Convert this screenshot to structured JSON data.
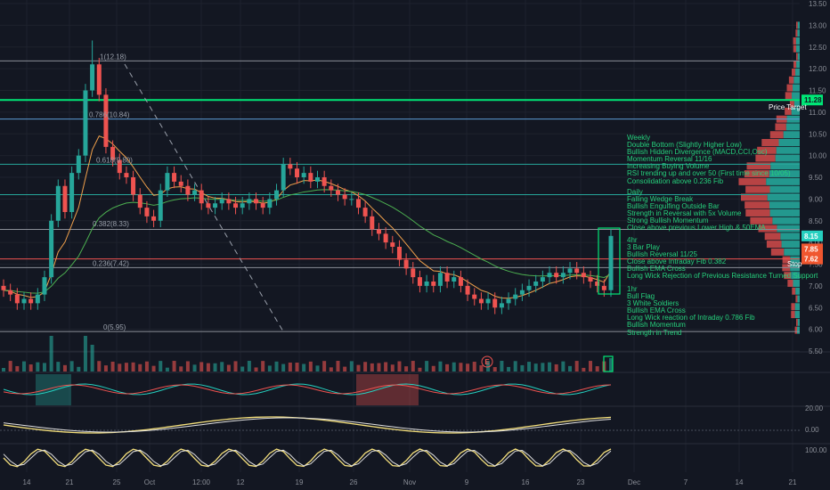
{
  "chart_data": {
    "type": "candlestick",
    "y_axis_ticks": [
      "13.50",
      "13.00",
      "12.50",
      "12.00",
      "11.50",
      "11.00",
      "10.50",
      "10.00",
      "9.50",
      "9.00",
      "8.50",
      "8.00",
      "7.50",
      "7.00",
      "6.50",
      "6.00",
      "5.50"
    ],
    "ylim": [
      5.0,
      13.6
    ],
    "x_axis_ticks": [
      "14",
      "21",
      "25",
      "Oct",
      "12:00",
      "12",
      "19",
      "26",
      "Nov",
      "9",
      "16",
      "23",
      "Dec",
      "7",
      "14",
      "21"
    ],
    "fib_levels": [
      {
        "label": "1(12.18)",
        "value": 12.18
      },
      {
        "label": "0.786(10.84)",
        "value": 10.84
      },
      {
        "label": "0.618(9.80)",
        "value": 9.8
      },
      {
        "label": "0.382(8.33)",
        "value": 8.33
      },
      {
        "label": "0.236(7.42)",
        "value": 7.42
      },
      {
        "label": "0(5.95)",
        "value": 5.95
      }
    ],
    "horizontal_levels": [
      12.18,
      11.28,
      10.84,
      9.8,
      9.1,
      8.3,
      7.62,
      7.42,
      5.95
    ],
    "price_labels": [
      {
        "text": "11.28",
        "color": "#26d07c"
      },
      {
        "text": "8.15",
        "color": "#131722"
      },
      {
        "text": "7.85",
        "color": "#f0562f"
      },
      {
        "text": "7.62",
        "color": "#f0562f"
      }
    ],
    "price_target_label": "Price Target",
    "stop_label": "Stop",
    "earnings_marker": "E",
    "oscillator1_ticks": [],
    "oscillator2_ticks": [
      "20.00",
      "0.00"
    ],
    "oscillator3_ticks": [
      "100.00"
    ],
    "candles_close_estimate": [
      6.9,
      6.8,
      6.6,
      6.7,
      6.6,
      6.8,
      7.2,
      8.5,
      9.3,
      8.7,
      9.6,
      10.0,
      11.5,
      12.1,
      11.4,
      10.2,
      9.9,
      9.6,
      9.5,
      9.1,
      8.8,
      8.6,
      8.5,
      9.2,
      9.6,
      9.4,
      9.3,
      9.1,
      9.2,
      8.9,
      8.8,
      8.9,
      9.0,
      8.9,
      8.8,
      8.9,
      9.0,
      8.9,
      8.8,
      9.0,
      9.2,
      9.8,
      9.7,
      9.5,
      9.6,
      9.4,
      9.5,
      9.3,
      9.2,
      9.1,
      9.0,
      9.0,
      8.8,
      8.6,
      8.3,
      8.2,
      8.0,
      7.9,
      7.6,
      7.4,
      7.2,
      7.0,
      7.1,
      7.0,
      7.3,
      7.1,
      7.2,
      7.0,
      6.8,
      6.7,
      6.6,
      6.7,
      6.5,
      6.6,
      6.7,
      6.8,
      6.9,
      7.0,
      7.1,
      7.2,
      7.3,
      7.2,
      7.3,
      7.4,
      7.3,
      7.2,
      7.1,
      7.0,
      6.9,
      8.15
    ]
  },
  "notes": {
    "weekly": [
      "Weekly",
      "Double Bottom (Slightly Higher Low)",
      "Bullish Hidden Divergence (MACD,CCI,Osc)",
      "Momentum Reversal 11/16",
      "Increasing Buying Volume",
      "RSI trending up and over 50 (First time since 10/05)",
      "Consolidation above 0.236 Fib"
    ],
    "daily": [
      "Daily",
      "Falling Wedge Break",
      "Bullish Engulfing Outside Bar",
      "Strength in Reversal with 5x Volume",
      "Strong Bullish Momentum",
      "Close above previous Lower High & 50EMA"
    ],
    "four_hr": [
      "4hr",
      "3 Bar Play",
      "Bullish Reversal 11/25",
      "Close above Intraday Fib 0.382",
      "Bullish EMA Cross",
      "Long Wick Rejection of Previous Resistance Turned Support"
    ],
    "one_hr": [
      "1hr",
      "Bull Flag",
      "3 White Soldiers",
      "Bullish EMA Cross",
      "Long Wick reaction of Intraday 0.786 Fib",
      "Bullish Momentum",
      "Strength in Trend"
    ]
  },
  "colors": {
    "background": "#131722",
    "up": "#26a69a",
    "down": "#ef5350",
    "level": "#8a8e97",
    "target": "#00e676",
    "note": "#26d07c"
  }
}
